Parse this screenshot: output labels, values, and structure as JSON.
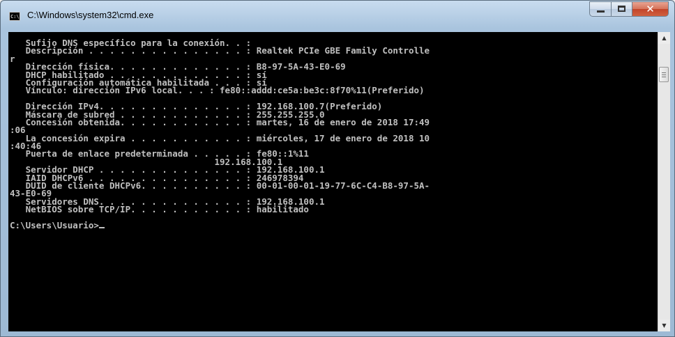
{
  "window": {
    "title": "C:\\Windows\\system32\\cmd.exe",
    "icon": "cmd-icon",
    "icon_text": "C:\\",
    "buttons": {
      "minimize": "minimize-icon",
      "maximize": "maximize-icon",
      "close": "✕"
    }
  },
  "console": {
    "lines": [
      "   Sufijo DNS específico para la conexión. . :",
      "   Descripción . . . . . . . . . . . . . . . : Realtek PCIe GBE Family Controlle",
      "r",
      "   Dirección física. . . . . . . . . . . . . : B8-97-5A-43-E0-69",
      "   DHCP habilitado . . . . . . . . . . . . . : sí",
      "   Configuración automática habilitada . . . : sí",
      "   Vínculo: dirección IPv6 local. . . : fe80::addd:ce5a:be3c:8f70%11(Preferido)",
      "",
      "   Dirección IPv4. . . . . . . . . . . . . . : 192.168.100.7(Preferido)",
      "   Máscara de subred . . . . . . . . . . . . : 255.255.255.0",
      "   Concesión obtenida. . . . . . . . . . . . : martes, 16 de enero de 2018 17:49",
      ":06",
      "   La concesión expira . . . . . . . . . . . : miércoles, 17 de enero de 2018 10",
      ":40:46",
      "   Puerta de enlace predeterminada . . . . . : fe80::1%11",
      "                                       192.168.100.1",
      "   Servidor DHCP . . . . . . . . . . . . . . : 192.168.100.1",
      "   IAID DHCPv6 . . . . . . . . . . . . . . . : 246978394",
      "   DUID de cliente DHCPv6. . . . . . . . . . : 00-01-00-01-19-77-6C-C4-B8-97-5A-",
      "43-E0-69",
      "   Servidores DNS. . . . . . . . . . . . . . : 192.168.100.1",
      "   NetBIOS sobre TCP/IP. . . . . . . . . . . : habilitado",
      ""
    ],
    "prompt": "C:\\Users\\Usuario>",
    "colors": {
      "background": "#000000",
      "text": "#c0c0c0"
    }
  },
  "scrollbar": {
    "up": "▲",
    "down": "▼"
  }
}
